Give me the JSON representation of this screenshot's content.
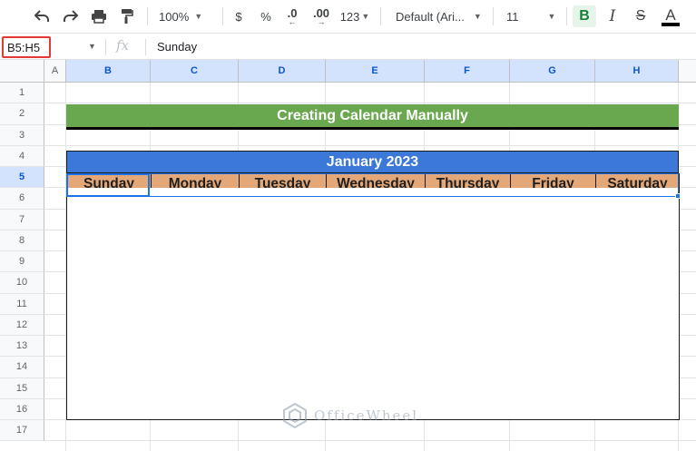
{
  "toolbar": {
    "zoom": "100%",
    "currency": "$",
    "percent": "%",
    "decrease_decimal": ".0",
    "increase_decimal": ".00",
    "more_formats": "123",
    "font": "Default (Ari...",
    "font_size": "11",
    "bold": "B",
    "italic": "I",
    "strikethrough": "S",
    "text_color": "A"
  },
  "formula_bar": {
    "name_box": "B5:H5",
    "fx": "fx",
    "value": "Sunday"
  },
  "columns": [
    "A",
    "B",
    "C",
    "D",
    "E",
    "F",
    "G",
    "H"
  ],
  "rows": [
    "1",
    "2",
    "3",
    "4",
    "5",
    "6",
    "7",
    "8",
    "9",
    "10",
    "11",
    "12",
    "13",
    "14",
    "15",
    "16",
    "17"
  ],
  "sheet": {
    "title": "Creating Calendar Manually",
    "month": "January 2023",
    "days": [
      "Sunday",
      "Monday",
      "Tuesday",
      "Wednesday",
      "Thursday",
      "Friday",
      "Saturday"
    ]
  },
  "watermark": "OfficeWheel",
  "colors": {
    "title_bg": "#6aa84f",
    "month_bg": "#3c78d8",
    "day_header_bg": "#e4a878",
    "selection": "#1a73e8",
    "name_box_highlight": "#e53935"
  }
}
